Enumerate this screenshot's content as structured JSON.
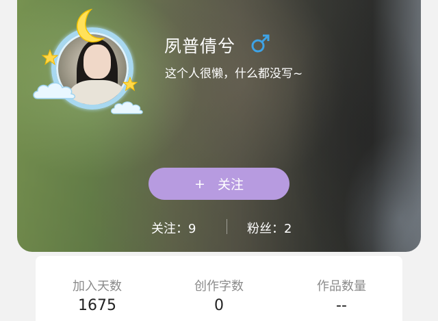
{
  "profile": {
    "username": "夙普倩兮",
    "gender_icon": "male-icon",
    "signature": "这个人很懒，什么都没写~",
    "follow_button": {
      "plus": "+",
      "label": "关注"
    },
    "following": "关注：9",
    "fans": "粉丝：2"
  },
  "stats": [
    {
      "label": "加入天数",
      "value": "1675"
    },
    {
      "label": "创作字数",
      "value": "0"
    },
    {
      "label": "作品数量",
      "value": "--"
    }
  ],
  "colors": {
    "accent": "#b79be0",
    "gender": "#3ea3e6",
    "avatar_frame": "#a8d8f0"
  }
}
